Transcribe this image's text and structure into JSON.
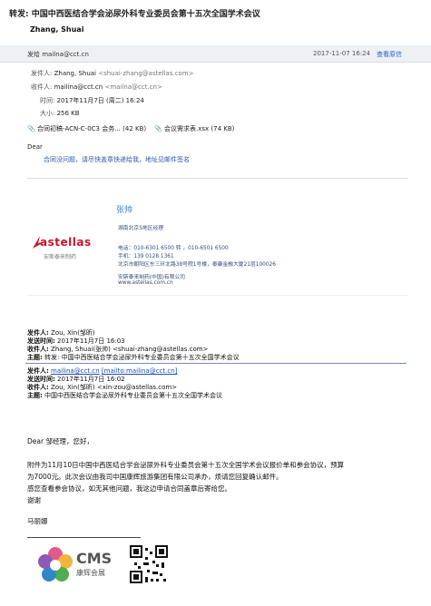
{
  "header": {
    "subject": "转发: 中国中西医结合学会泌尿外科专业委员会第十五次全国学术会议",
    "sender_name": "Zhang, Shuai",
    "send_to_label": "发给 mailna@cct.cn",
    "date": "2017-11-07 16:24",
    "more_link": "查看原信"
  },
  "details": {
    "from_label": "发件人:",
    "from_value": "Zhang, Shuai",
    "from_email": "<shuai-zhang@astellas.com>",
    "to_label": "收件人:",
    "to_value": "mailina@cct.cn",
    "to_email": "<mailna@cct.cn>",
    "time_label": "时间:",
    "time_value": "2017年11月7日 (周二) 16:24",
    "size_label": "大小:",
    "size_value": "256 KB"
  },
  "attachments": [
    {
      "name": "合同初稿-ACN-C-0C3 会务...",
      "size": "(42 KB)"
    },
    {
      "name": "会议需求表.xsx",
      "size": "(74 KB)"
    }
  ],
  "body": {
    "greeting": "Dear",
    "line1": "合同没问题，请尽快盖章快递给我，地址见邮件签名"
  },
  "signature": {
    "logo_text": "astellas",
    "logo_sub": "安斯泰来制药",
    "name": "张帅",
    "title": "湖南北京S地区经理",
    "phone": "电话：010-6301 6500 转 ，010-6501 6500",
    "mobile": "手机：139 0128 1361",
    "address": "北京市朝阳区东三环北路38号院1号楼，泰康金融大厦21层100026",
    "company": "安斯泰来制药(中国)有限公司",
    "website": "www.astellas.com.cn"
  },
  "quote1": {
    "from_label": "发件人:",
    "from_value": "Zou, Xin(邹昕)",
    "time_label": "发送时间:",
    "time_value": "2017年11月7日 16:03",
    "to_label": "收件人:",
    "to_value": "Zhang, Shuai(张帅) <shuai-zhang@astellas.com>",
    "subject_label": "主题:",
    "subject_value": "转发: 中国中西医结合学会泌尿外科专业委员会第十五次全国学术会议"
  },
  "quote2": {
    "from_label": "发件人:",
    "from_value": "mailina@cct.cn",
    "from_link": "[mailto:mailina@cct.cn]",
    "time_label": "发送时间:",
    "time_value": "2017年11月7日 16:02",
    "to_label": "收件人:",
    "to_value": "Zou, Xin(邹昕) <xin-zou@astellas.com>",
    "subject_label": "主题:",
    "subject_value": "中国中西医结合学会泌尿外科专业委员会第十五次全国学术会议"
  },
  "message": {
    "greeting": "Dear 邹经理，您好，",
    "para1": "附件为11月10日中国中西医结合学会泌尿外科专业委员会第十五次全国学术会议报价单和参会协议，预算",
    "para2": "为7000元。此次会议由我司中国康辉旅游集团有限公司承办，烦请您回复确认邮件。",
    "para3": "感您查看参会协议，如无其他问题，我这边申请合同盖章后寄给您。",
    "thanks": "谢谢",
    "signoff": "马丽娜"
  },
  "footer_logo": {
    "brand": "CMS",
    "sub": "康辉会展"
  },
  "colors": {
    "astellas_red": "#d0112b",
    "body_blue": "#2a57a5",
    "link_blue": "#1a63c7"
  }
}
